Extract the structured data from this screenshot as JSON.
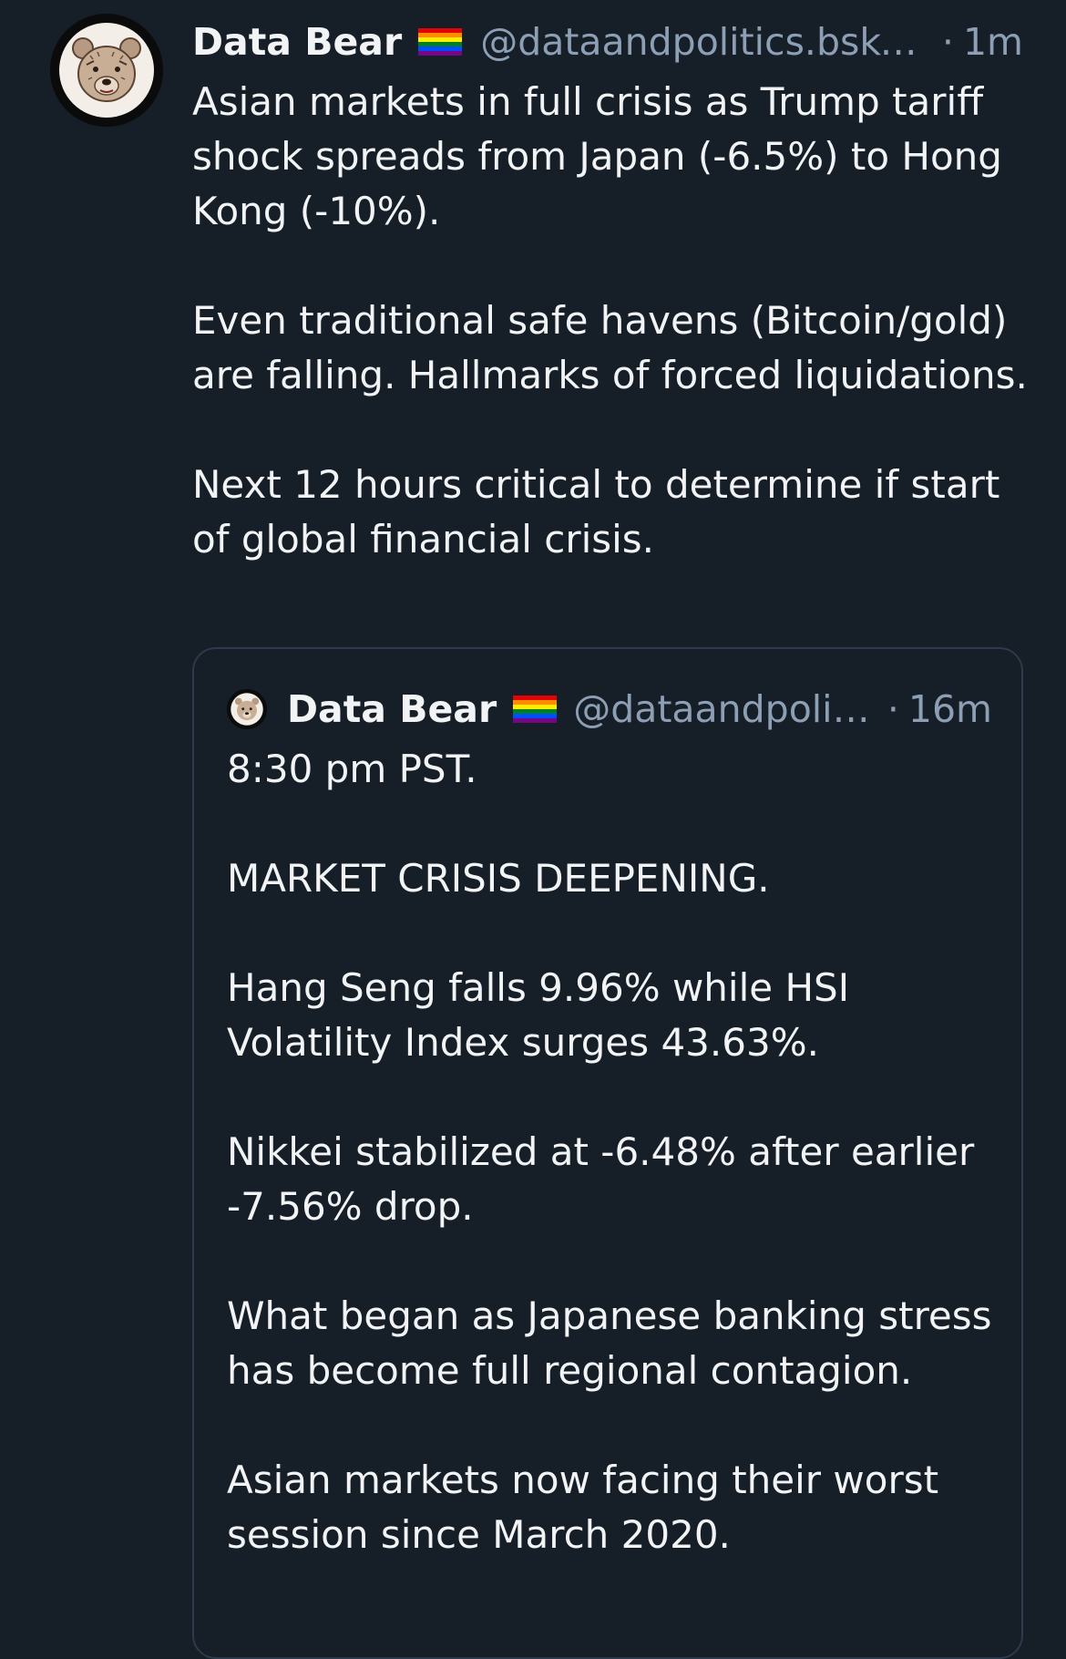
{
  "post": {
    "author_name": "Data Bear",
    "author_flag_icon": "rainbow-flag-icon",
    "handle": "@dataandpolitics.bsky...",
    "separator": "·",
    "time": "1m",
    "paragraphs": [
      "Asian markets in full crisis as Trump tariff shock spreads from Japan (-6.5%) to Hong Kong (-10%).",
      "Even traditional safe havens (Bitcoin/gold) are falling. Hallmarks of forced liquidations.",
      "Next 12 hours critical to determine if start of global financial crisis."
    ]
  },
  "quote": {
    "author_name": "Data Bear",
    "author_flag_icon": "rainbow-flag-icon",
    "handle": "@dataandpolit...",
    "separator": "·",
    "time": "16m",
    "paragraphs": [
      "8:30 pm PST.",
      "MARKET CRISIS DEEPENING.",
      "Hang Seng falls 9.96% while HSI Volatility Index surges 43.63%.",
      "Nikkei stabilized at -6.48% after earlier -7.56% drop.",
      "What began as Japanese banking stress has become full regional contagion.",
      "Asian markets now facing their worst session since March 2020."
    ]
  },
  "colors": {
    "background": "#161e27",
    "text_primary": "#f1f3f5",
    "text_secondary": "#8d9fb5",
    "quote_border": "#2c3a4b"
  }
}
